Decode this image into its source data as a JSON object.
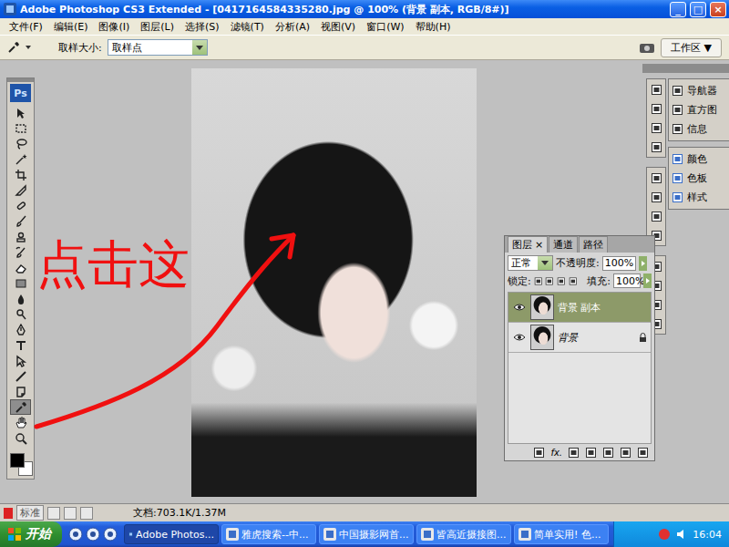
{
  "window": {
    "title": "Adobe Photoshop CS3 Extended - [0417164584335280.jpg @ 100% (背景 副本, RGB/8#)]",
    "controls": [
      "_",
      "□",
      "×"
    ]
  },
  "menu": [
    "文件(F)",
    "编辑(E)",
    "图像(I)",
    "图层(L)",
    "选择(S)",
    "滤镜(T)",
    "分析(A)",
    "视图(V)",
    "窗口(W)",
    "帮助(H)"
  ],
  "options": {
    "label": "取样大小:",
    "sample": "取样点",
    "workspace": "工作区 ▼"
  },
  "toolbox": {
    "logo": "Ps",
    "tools": [
      {
        "selected": false
      },
      {
        "selected": false
      },
      {
        "selected": false
      },
      {
        "selected": false
      },
      {
        "selected": false
      },
      {
        "selected": false
      },
      {
        "selected": false
      },
      {
        "selected": false
      },
      {
        "selected": false
      },
      {
        "selected": false
      },
      {
        "selected": false
      },
      {
        "selected": false
      },
      {
        "selected": false
      },
      {
        "selected": false
      },
      {
        "selected": false
      },
      {
        "selected": false
      },
      {
        "selected": false
      },
      {
        "selected": false
      },
      {
        "selected": false
      },
      {
        "selected": true
      },
      {
        "selected": false
      },
      {
        "selected": false
      }
    ]
  },
  "annotation": {
    "text": "点击这"
  },
  "layers_panel": {
    "tabs": [
      {
        "label": "图层",
        "selected": true
      },
      {
        "label": "通道",
        "selected": false
      },
      {
        "label": "路径",
        "selected": false
      }
    ],
    "close": "×",
    "blend": "正常",
    "opacity_label": "不透明度:",
    "opacity": "100%",
    "lock_label": "锁定:",
    "fill_label": "填充:",
    "fill": "100%",
    "layers": [
      {
        "name": "背景 副本",
        "selected": true,
        "locked": false,
        "visible": true
      },
      {
        "name": "背景",
        "selected": false,
        "locked": true,
        "visible": true
      }
    ],
    "fx": "fx."
  },
  "dock": {
    "groups": [
      [
        "导航器",
        "直方图",
        "信息"
      ],
      [
        "颜色",
        "色板",
        "样式"
      ]
    ]
  },
  "status_bar": {
    "mode": "标准",
    "doc": "文档:703.1K/1.37M"
  },
  "taskbar": {
    "start": "开始",
    "tasks": [
      {
        "label": "Adobe Photos...",
        "selected": true
      },
      {
        "label": "雅虎搜索--中...",
        "selected": false
      },
      {
        "label": "中国摄影网首...",
        "selected": false
      },
      {
        "label": "皆高近摄接图...",
        "selected": false
      },
      {
        "label": "简单实用! 色...",
        "selected": false
      }
    ],
    "time": "16:04"
  }
}
